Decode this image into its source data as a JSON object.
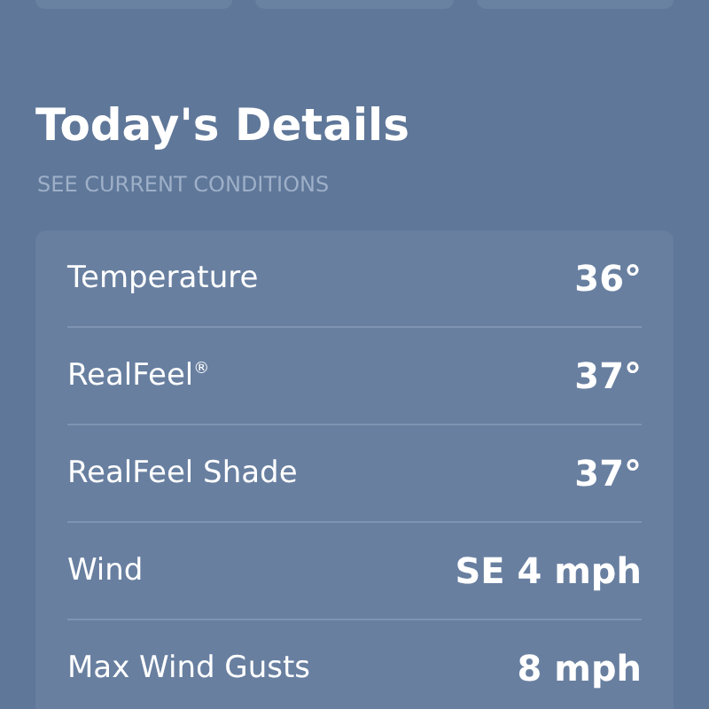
{
  "title": "Today's Details",
  "subtitle": "SEE CURRENT CONDITIONS",
  "details": [
    {
      "label": "Temperature",
      "value": "36°"
    },
    {
      "label": "RealFeel$^{®}$",
      "value": "37°"
    },
    {
      "label": "RealFeel Shade",
      "value": "37°"
    },
    {
      "label": "Wind",
      "value": "SE 4 mph"
    },
    {
      "label": "Max Wind Gusts",
      "value": "8 mph"
    }
  ]
}
